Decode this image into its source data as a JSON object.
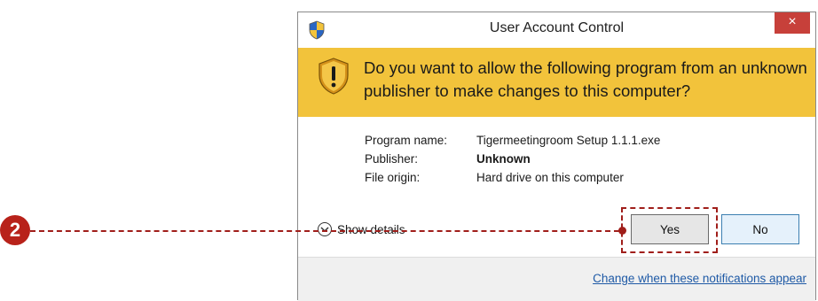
{
  "dialog": {
    "title": "User Account Control",
    "close_label": "×",
    "question": "Do you want to allow the following program from an unknown publisher to make changes to this computer?",
    "program_label": "Program name:",
    "program_value": "Tigermeetingroom Setup 1.1.1.exe",
    "publisher_label": "Publisher:",
    "publisher_value": "Unknown",
    "origin_label": "File origin:",
    "origin_value": "Hard drive on this computer",
    "show_details": "Show details",
    "yes_label": "Yes",
    "no_label": "No",
    "footer_link": "Change when these notifications appear"
  },
  "annotation": {
    "step_number": "2"
  },
  "colors": {
    "banner": "#f2c33b",
    "close": "#c7403a",
    "callout": "#a01e1a",
    "link": "#1f5aa6"
  },
  "icons": [
    "uac-shield-icon",
    "warning-shield-icon",
    "chevron-down-icon",
    "close-icon"
  ]
}
